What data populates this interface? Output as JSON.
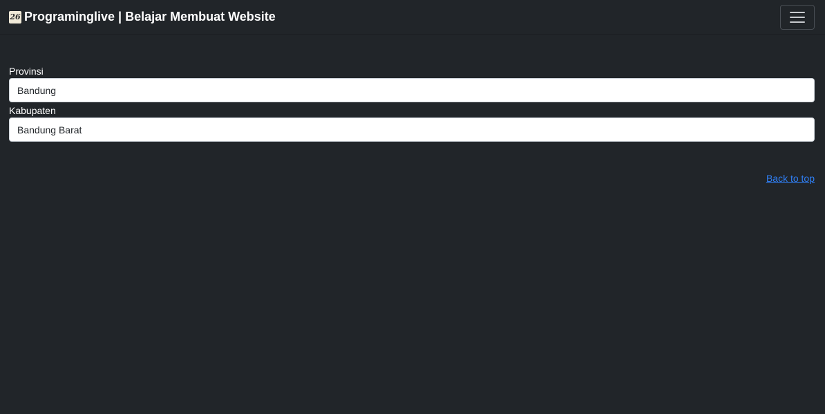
{
  "navbar": {
    "brand_logo_text": "26",
    "brand_title": "Programinglive | Belajar Membuat Website",
    "toggle_icon": "hamburger-icon"
  },
  "form": {
    "provinsi": {
      "label": "Provinsi",
      "value": "Bandung"
    },
    "kabupaten": {
      "label": "Kabupaten",
      "value": "Bandung Barat"
    }
  },
  "footer": {
    "back_to_top": "Back to top"
  },
  "colors": {
    "background": "#212529",
    "link": "#2f7ff5"
  }
}
